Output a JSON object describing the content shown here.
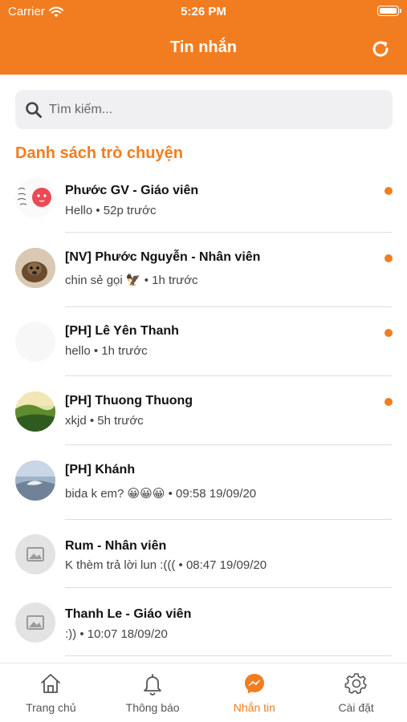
{
  "status_bar": {
    "carrier": "Carrier",
    "time": "5:26 PM"
  },
  "header": {
    "title": "Tin nhắn"
  },
  "search": {
    "placeholder": "Tìm kiếm..."
  },
  "section_title": "Danh sách trò chuyện",
  "conversations": [
    {
      "name": "Phước GV - Giáo viên",
      "preview": "Hello • 52p trước",
      "unread": true
    },
    {
      "name": "[NV] Phước Nguyễn - Nhân viên",
      "preview": "chin sẻ gọi 🦅 • 1h trước",
      "unread": true
    },
    {
      "name": "[PH] Lê Yên Thanh",
      "preview": "hello • 1h trước",
      "unread": true
    },
    {
      "name": "[PH] Thuong Thuong",
      "preview": "xkjd • 5h trước",
      "unread": true
    },
    {
      "name": "[PH] Khánh",
      "preview": "bida k em? 😀😀😀 • 09:58 19/09/20",
      "unread": false
    },
    {
      "name": "Rum - Nhân viên",
      "preview": "K thèm trả lời lun :((( • 08:47 19/09/20",
      "unread": false
    },
    {
      "name": "Thanh Le - Giáo viên",
      "preview": ":)) • 10:07 18/09/20",
      "unread": false
    }
  ],
  "tabs": [
    {
      "label": "Trang chủ",
      "icon": "home-icon"
    },
    {
      "label": "Thông báo",
      "icon": "bell-icon"
    },
    {
      "label": "Nhắn tin",
      "icon": "messenger-icon"
    },
    {
      "label": "Cài đặt",
      "icon": "gear-icon"
    }
  ],
  "colors": {
    "accent": "#f27d20",
    "unread_dot": "#f27d20"
  }
}
